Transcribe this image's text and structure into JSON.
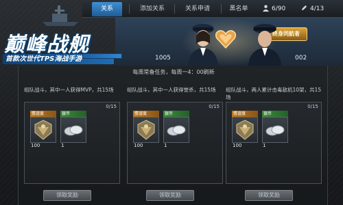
{
  "logo": {
    "title": "巅峰战舰",
    "subtitle": "首款次世代TPS海战手游"
  },
  "tabs": [
    {
      "label": "关系",
      "active": true
    },
    {
      "label": "添加关系",
      "active": false
    },
    {
      "label": "关系申请",
      "active": false
    },
    {
      "label": "黑名单",
      "active": false
    }
  ],
  "counters": {
    "friends": "6/90",
    "mail": "4/13"
  },
  "banner": {
    "left_value": "1005",
    "right_value": "002",
    "badge": "终身同航者"
  },
  "notice": "每周常备任务，每周一4：00刷新",
  "cards": [
    {
      "title": "组队战斗，其中一人获得MVP，共15场",
      "progress": "0/15",
      "rewards": [
        {
          "tag": "情谊度",
          "amount": "100",
          "color": "gold"
        },
        {
          "tag": "银币",
          "amount": "1",
          "color": "green"
        }
      ],
      "claim_label": "领取奖励"
    },
    {
      "title": "组队战斗，其中一人获得誉杀，共15场",
      "progress": "0/15",
      "rewards": [
        {
          "tag": "情谊度",
          "amount": "100",
          "color": "gold"
        },
        {
          "tag": "银币",
          "amount": "1",
          "color": "green"
        }
      ],
      "claim_label": "领取奖励"
    },
    {
      "title": "组队战斗，两人累计击毒敌机10架，共15场",
      "progress": "0/15",
      "rewards": [
        {
          "tag": "情谊度",
          "amount": "100",
          "color": "gold"
        },
        {
          "tag": "银币",
          "amount": "1",
          "color": "green"
        }
      ],
      "claim_label": "领取奖励"
    }
  ]
}
